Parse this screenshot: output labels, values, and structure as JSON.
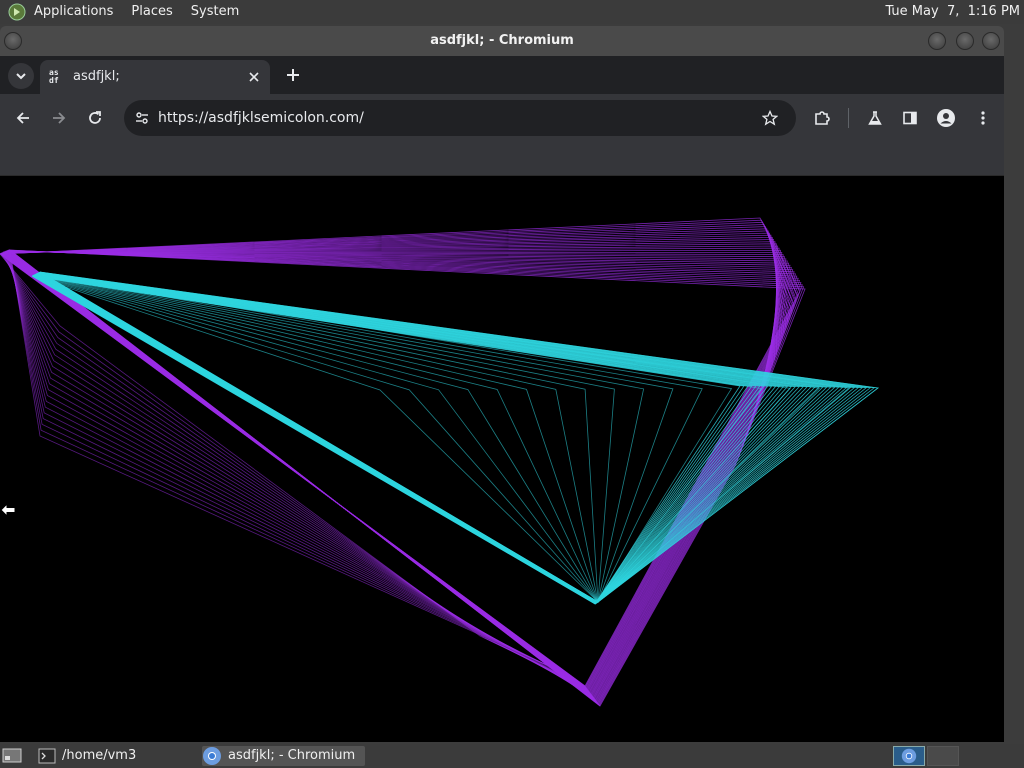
{
  "top_panel": {
    "menus": [
      "Applications",
      "Places",
      "System"
    ],
    "clock": "Tue May  7,  1:16 PM"
  },
  "window": {
    "title": "asdfjkl; - Chromium"
  },
  "browser": {
    "tab": {
      "favicon_text_1": "as",
      "favicon_text_2": "df",
      "title": "asdfjkl;"
    },
    "url": "https://asdfjklsemicolon.com/"
  },
  "artwork": {
    "colors": {
      "purple": "#9b2ee6",
      "cyan": "#2fd6e0",
      "background": "#000000"
    }
  },
  "bottom_panel": {
    "tasks": [
      {
        "label": "/home/vm3"
      },
      {
        "label": "asdfjkl; - Chromium"
      }
    ]
  }
}
